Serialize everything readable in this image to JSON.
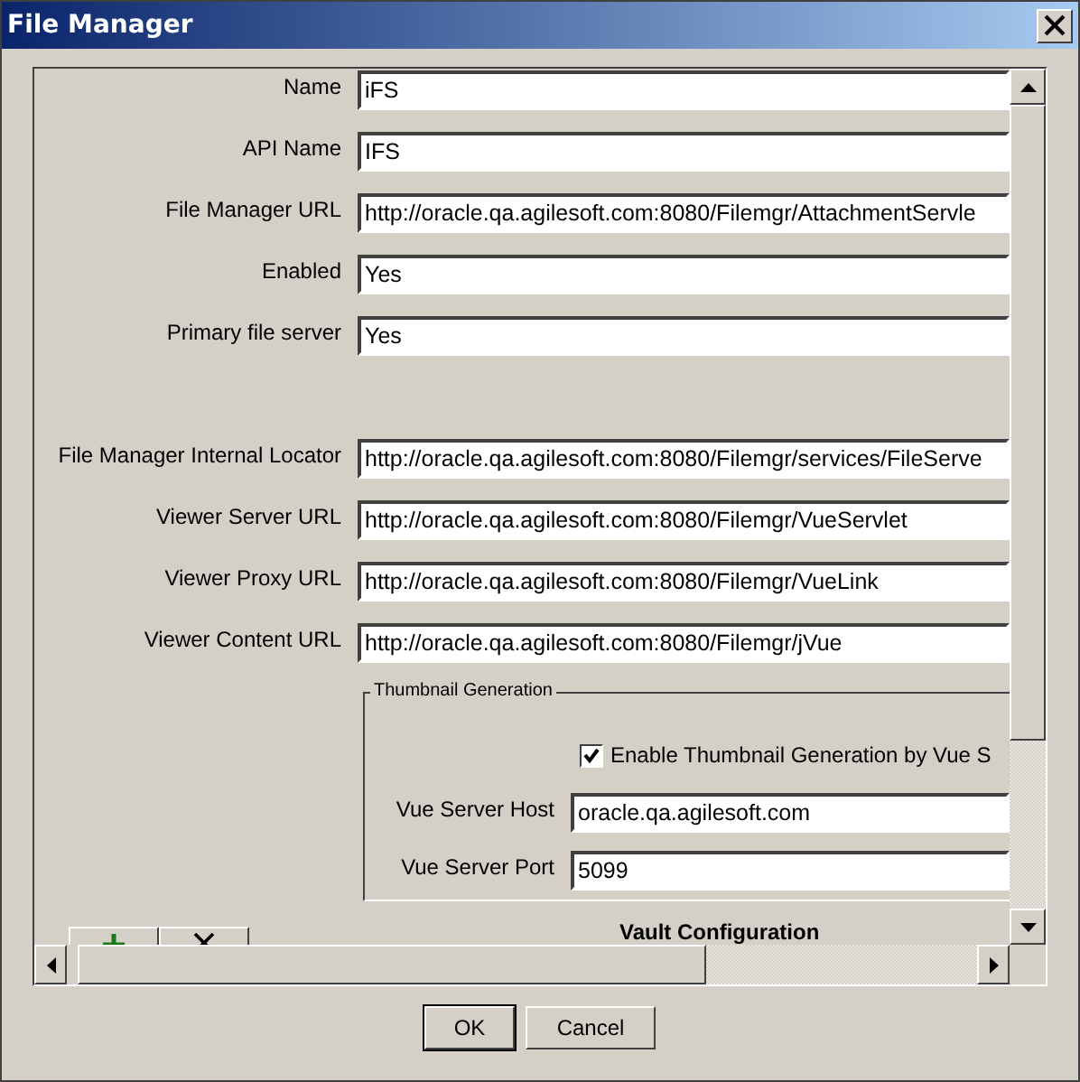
{
  "window": {
    "title": "File Manager"
  },
  "fields": [
    {
      "label": "Name",
      "value": "iFS"
    },
    {
      "label": "API Name",
      "value": "IFS"
    },
    {
      "label": "File Manager URL",
      "value": "http://oracle.qa.agilesoft.com:8080/Filemgr/AttachmentServle"
    },
    {
      "label": "Enabled",
      "value": "Yes"
    },
    {
      "label": "Primary file server",
      "value": "Yes"
    }
  ],
  "viewer_fields": [
    {
      "label": "File Manager Internal Locator",
      "value": "http://oracle.qa.agilesoft.com:8080/Filemgr/services/FileServe"
    },
    {
      "label": "Viewer Server URL",
      "value": "http://oracle.qa.agilesoft.com:8080/Filemgr/VueServlet"
    },
    {
      "label": "Viewer Proxy URL",
      "value": "http://oracle.qa.agilesoft.com:8080/Filemgr/VueLink"
    },
    {
      "label": "Viewer Content URL",
      "value": "http://oracle.qa.agilesoft.com:8080/Filemgr/jVue"
    }
  ],
  "thumbnail_group": {
    "title": "Thumbnail Generation",
    "checkbox": {
      "label": "Enable Thumbnail Generation by Vue S",
      "checked": true
    },
    "fields": [
      {
        "label": "Vue Server Host",
        "value": "oracle.qa.agilesoft.com"
      },
      {
        "label": "Vue Server Port",
        "value": "5099"
      }
    ]
  },
  "vault_heading": "Vault Configuration",
  "buttons": [
    "OK",
    "Cancel"
  ]
}
